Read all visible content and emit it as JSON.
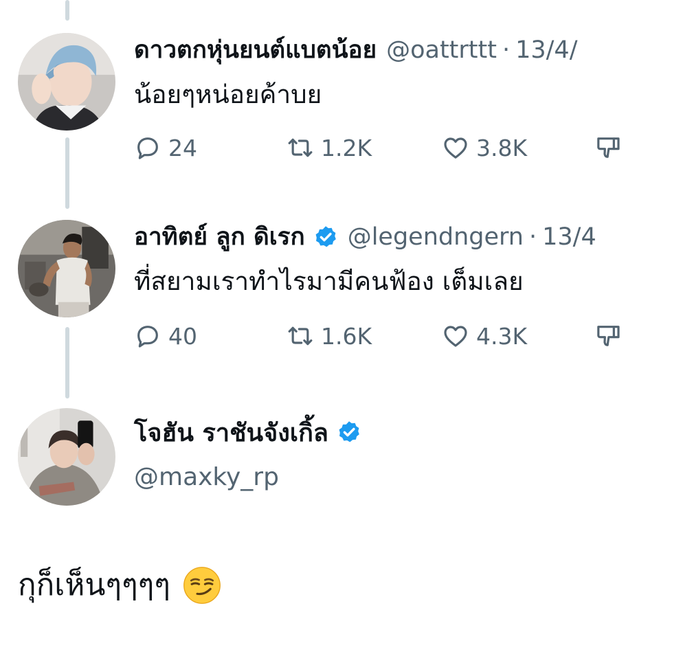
{
  "thread": [
    {
      "display_name": "ดาวตกหุ่นยนต์แบตน้อย",
      "handle": "@oattrttt",
      "separator": "·",
      "date": "13/4/",
      "verified": false,
      "text": "น้อยๆหน่อยค้าบย",
      "replies": "24",
      "reposts": "1.2K",
      "likes": "3.8K",
      "avatar_icon": "avatar-blue-hair"
    },
    {
      "display_name": "อาทิตย์ ลูก ดิเรก",
      "handle": "@legendngern",
      "separator": "·",
      "date": "13/4",
      "verified": true,
      "text": "ที่สยามเราทำไรมามีคนฟ้อง เต็มเลย",
      "replies": "40",
      "reposts": "1.6K",
      "likes": "4.3K",
      "avatar_icon": "avatar-man-white-shirt"
    }
  ],
  "main_tweet": {
    "display_name": "โจฮัน ราชันจังเกิ้ล",
    "handle": "@maxky_rp",
    "verified": true,
    "text": "กุก็เห็นๆๆๆๆ",
    "emoji": "smirking-face",
    "avatar_icon": "avatar-mirror-selfie"
  },
  "icons": {
    "reply": "speech-bubble-icon",
    "repost": "repost-arrows-icon",
    "like": "heart-icon",
    "dislike": "thumbs-down-icon",
    "verified": "verified-badge-icon"
  },
  "colors": {
    "text": "#0f1419",
    "secondary": "#536471",
    "verified": "#1d9bf0",
    "thread_line": "#cfd9de"
  }
}
